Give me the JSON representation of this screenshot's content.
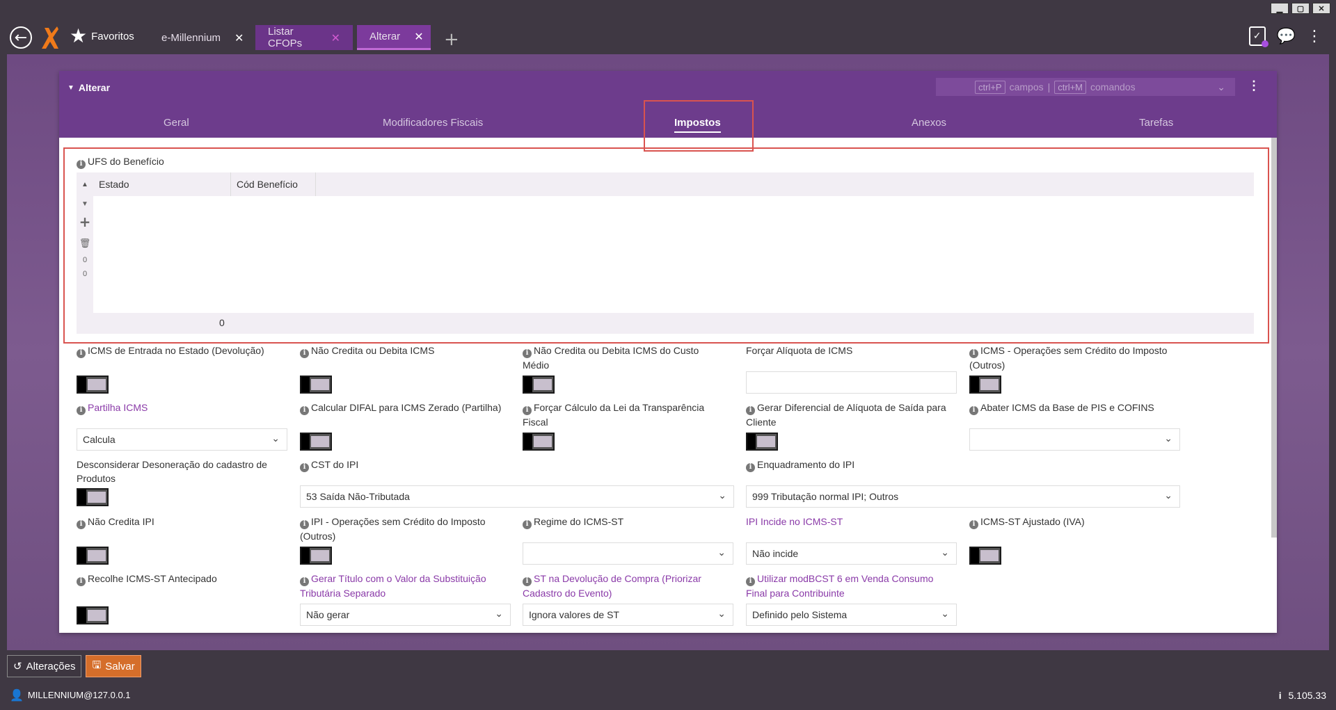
{
  "window": {
    "minimize": "▁",
    "maximize": "▢",
    "close": "✕"
  },
  "topbar": {
    "favorites_label": "Favoritos",
    "tabs": [
      {
        "label": "e-Millennium",
        "close": "✕"
      },
      {
        "label": "Listar CFOPs",
        "close": "✕"
      },
      {
        "label": "Alterar",
        "close": "✕"
      }
    ],
    "add_tab": "+"
  },
  "panel": {
    "title": "Alterar",
    "commands": {
      "fields_key": "ctrl+P",
      "fields_label": "campos",
      "sep": "|",
      "cmds_key": "ctrl+M",
      "cmds_label": "comandos"
    },
    "tabs": [
      "Geral",
      "Modificadores Fiscais",
      "Impostos",
      "Anexos",
      "Tarefas"
    ],
    "active_tab": "Impostos"
  },
  "ufs_section": {
    "title": "UFS do Benefício",
    "columns": [
      "Estado",
      "Cód Benefício"
    ],
    "side_counts": [
      "0",
      "0"
    ],
    "footer_count": "0"
  },
  "fields": {
    "icms_entrada": "ICMS de Entrada no Estado (Devolução)",
    "nao_credita_icms": "Não Credita ou Debita ICMS",
    "nao_credita_custo": "Não Credita ou Debita ICMS do Custo Médio",
    "forcar_aliquota": "Forçar Alíquota de ICMS",
    "icms_sem_credito": "ICMS - Operações sem Crédito do Imposto (Outros)",
    "partilha_icms": "Partilha ICMS",
    "partilha_value": "Calcula",
    "calcular_difal": "Calcular DIFAL para ICMS Zerado (Partilha)",
    "forcar_transparencia": "Forçar Cálculo da Lei da Transparência Fiscal",
    "gerar_diferencial": "Gerar Diferencial de Alíquota de Saída para Cliente",
    "abater_icms": "Abater ICMS da Base de PIS e COFINS",
    "desconsiderar": "Desconsiderar Desoneração do cadastro de Produtos",
    "cst_ipi": "CST do IPI",
    "cst_ipi_value": "53 Saída Não-Tributada",
    "enquadramento_ipi": "Enquadramento do IPI",
    "enquadramento_value": "999 Tributação normal IPI; Outros",
    "nao_credita_ipi": "Não Credita IPI",
    "ipi_sem_credito": "IPI - Operações sem Crédito do Imposto (Outros)",
    "regime_icms_st": "Regime do ICMS-ST",
    "ipi_incide": "IPI Incide no ICMS-ST",
    "ipi_incide_value": "Não incide",
    "icms_st_ajustado": "ICMS-ST Ajustado (IVA)",
    "recolhe_icms_st": "Recolhe ICMS-ST Antecipado",
    "gerar_titulo": "Gerar Título com o Valor da Substituição Tributária Separado",
    "gerar_titulo_value": "Não gerar",
    "st_devolucao": "ST na Devolução de Compra (Priorizar Cadastro do Evento)",
    "st_devolucao_value": "Ignora valores de ST",
    "modbcst": "Utilizar modBCST 6 em Venda Consumo Final para Contribuinte",
    "modbcst_value": "Definido pelo Sistema"
  },
  "bottom": {
    "history_label": "Alterações",
    "save_label": "Salvar"
  },
  "status": {
    "user": "MILLENNIUM@127.0.0.1",
    "version": "5.105.33"
  },
  "colors": {
    "accent": "#6d3c8c",
    "save": "#d56e2a",
    "highlight": "#d9534f"
  }
}
